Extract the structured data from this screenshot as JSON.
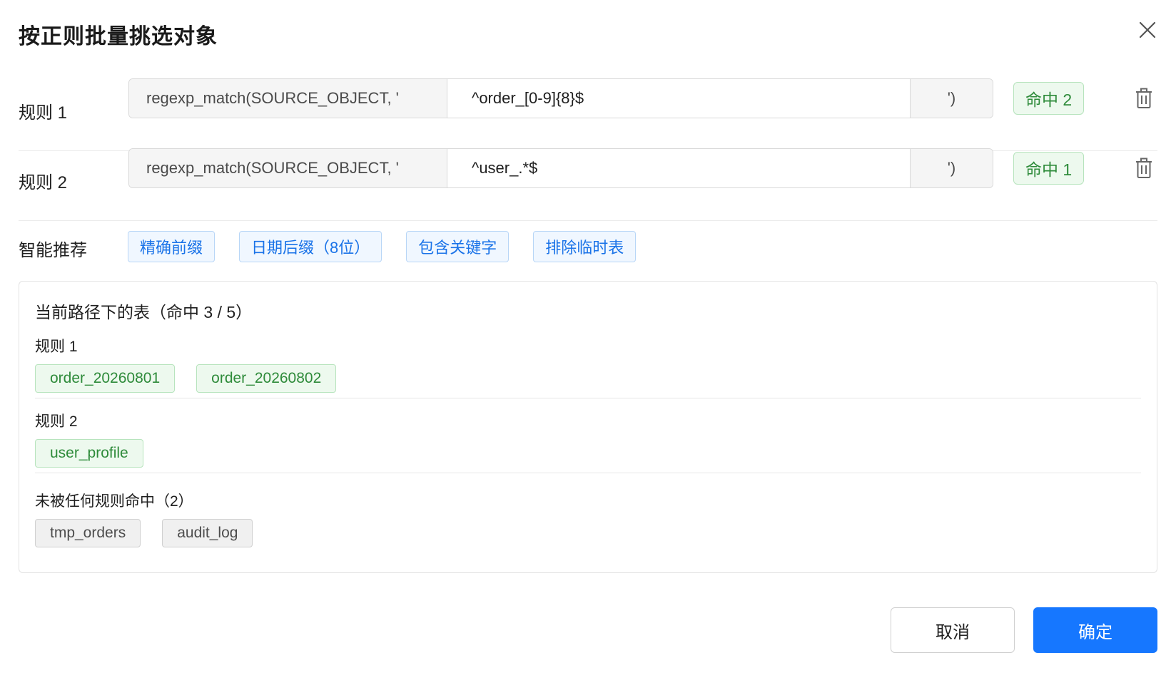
{
  "dialog": {
    "title": "按正则批量挑选对象",
    "close_icon": "close-icon"
  },
  "rules": [
    {
      "label": "规则 1",
      "prefix": "regexp_match(SOURCE_OBJECT, '",
      "pattern": "^order_[0-9]{8}$",
      "suffix": "')",
      "hit_badge": "命中 2",
      "delete_icon": "trash-icon"
    },
    {
      "label": "规则 2",
      "prefix": "regexp_match(SOURCE_OBJECT, '",
      "pattern": "^user_.*$",
      "suffix": "')",
      "hit_badge": "命中 1",
      "delete_icon": "trash-icon"
    }
  ],
  "suggestions": {
    "label": "智能推荐",
    "chips": [
      "精确前缀",
      "日期后缀（8位）",
      "包含关键字",
      "排除临时表"
    ]
  },
  "preview": {
    "title": "当前路径下的表（命中 3 / 5）",
    "groups": [
      {
        "label": "规则 1",
        "tags": [
          "order_20260801",
          "order_20260802"
        ],
        "status": "hit"
      },
      {
        "label": "规则 2",
        "tags": [
          "user_profile"
        ],
        "status": "hit"
      },
      {
        "label": "未被任何规则命中（2）",
        "tags": [
          "tmp_orders",
          "audit_log"
        ],
        "status": "miss"
      }
    ]
  },
  "footer": {
    "cancel_label": "取消",
    "confirm_label": "确定"
  },
  "colors": {
    "primary": "#1677ff",
    "hit_green": "#2e8b3a",
    "hit_bg": "#edf9ee",
    "chip_blue": "#1a73e8"
  }
}
